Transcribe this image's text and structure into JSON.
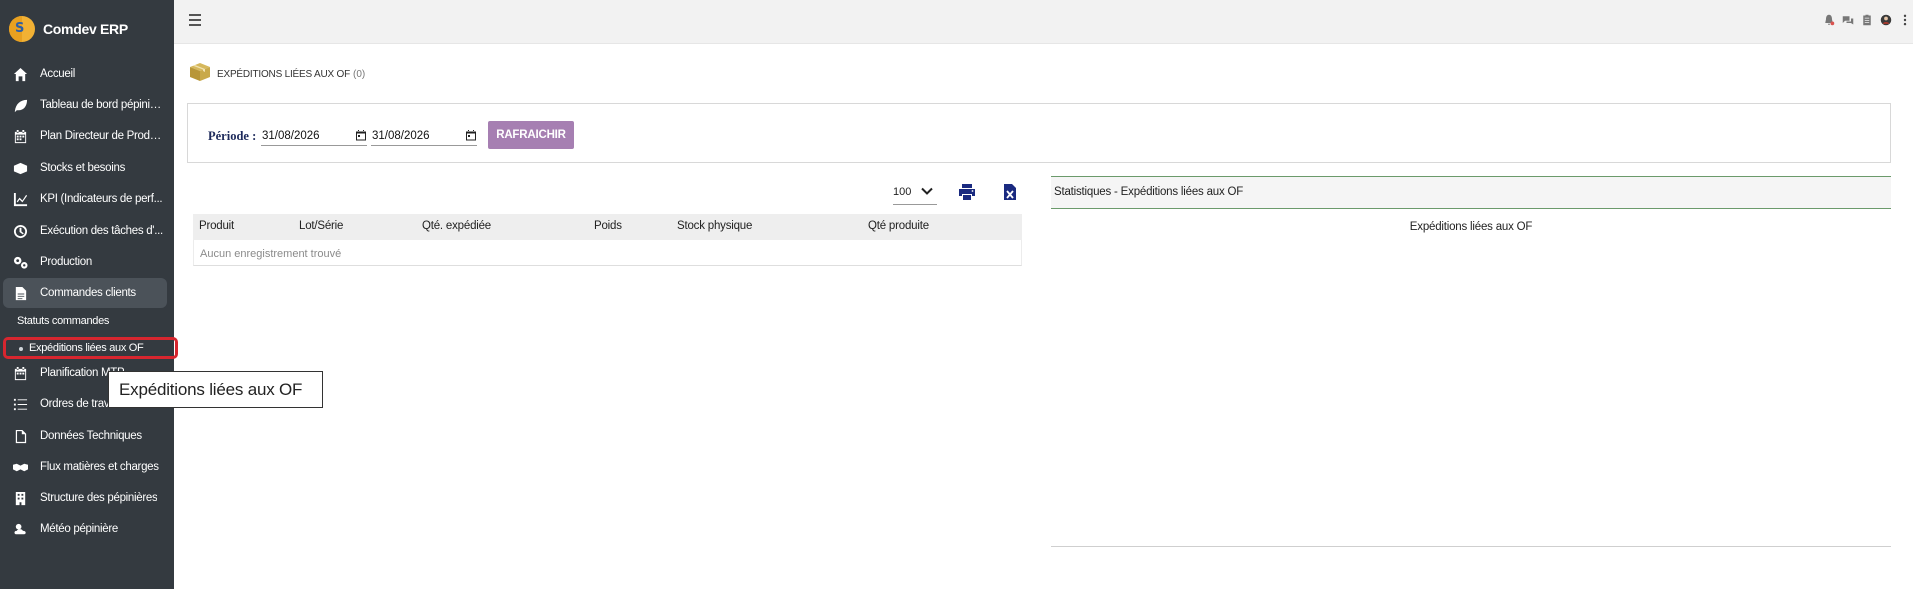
{
  "app": {
    "name": "Comdev ERP",
    "logo_letters": "S"
  },
  "sidebar": {
    "items": [
      {
        "label": "Accueil",
        "icon": "home-icon"
      },
      {
        "label": "Tableau de bord pépinière",
        "icon": "leaf-icon"
      },
      {
        "label": "Plan Directeur de Produ...",
        "icon": "calendar-icon"
      },
      {
        "label": "Stocks et besoins",
        "icon": "boxes-icon"
      },
      {
        "label": "KPI (Indicateurs de perf...",
        "icon": "chart-line-icon"
      },
      {
        "label": "Exécution des tâches d'...",
        "icon": "clock-icon"
      },
      {
        "label": "Production",
        "icon": "gears-icon"
      },
      {
        "label": "Commandes clients",
        "icon": "file-icon"
      },
      {
        "label": "Planification MTP",
        "icon": "calendar-icon"
      },
      {
        "label": "Ordres de travail",
        "icon": "list-check-icon"
      },
      {
        "label": "Données Techniques",
        "icon": "file-outline-icon"
      },
      {
        "label": "Flux matières et charges",
        "icon": "handshake-icon"
      },
      {
        "label": "Structure des pépinières",
        "icon": "building-icon"
      },
      {
        "label": "Météo pépinière",
        "icon": "cloud-sun-icon"
      }
    ],
    "sub_items": [
      {
        "label": "Statuts commandes"
      },
      {
        "label": "Expéditions liées aux OF"
      }
    ]
  },
  "tooltip": {
    "text": "Expéditions liées aux OF"
  },
  "topbar": {
    "icons": [
      "bell-icon",
      "chat-icon",
      "clipboard-icon",
      "user-avatar-icon",
      "kebab-menu-icon"
    ]
  },
  "page": {
    "title": "Expéditions liées aux OF",
    "count": "(0)"
  },
  "filter": {
    "period_label": "Période :",
    "date_from": "31/08/2026",
    "date_to": "31/08/2026",
    "refresh_label": "RAFRAICHIR"
  },
  "table": {
    "page_size": "100",
    "columns": [
      "Produit",
      "Lot/Série",
      "Qté. expédiée",
      "Poids",
      "Stock physique",
      "Qté produite"
    ],
    "empty_text": "Aucun enregistrement trouvé"
  },
  "stats": {
    "header": "Statistiques - Expéditions liées aux OF",
    "chart_title": "Expéditions liées aux OF"
  }
}
